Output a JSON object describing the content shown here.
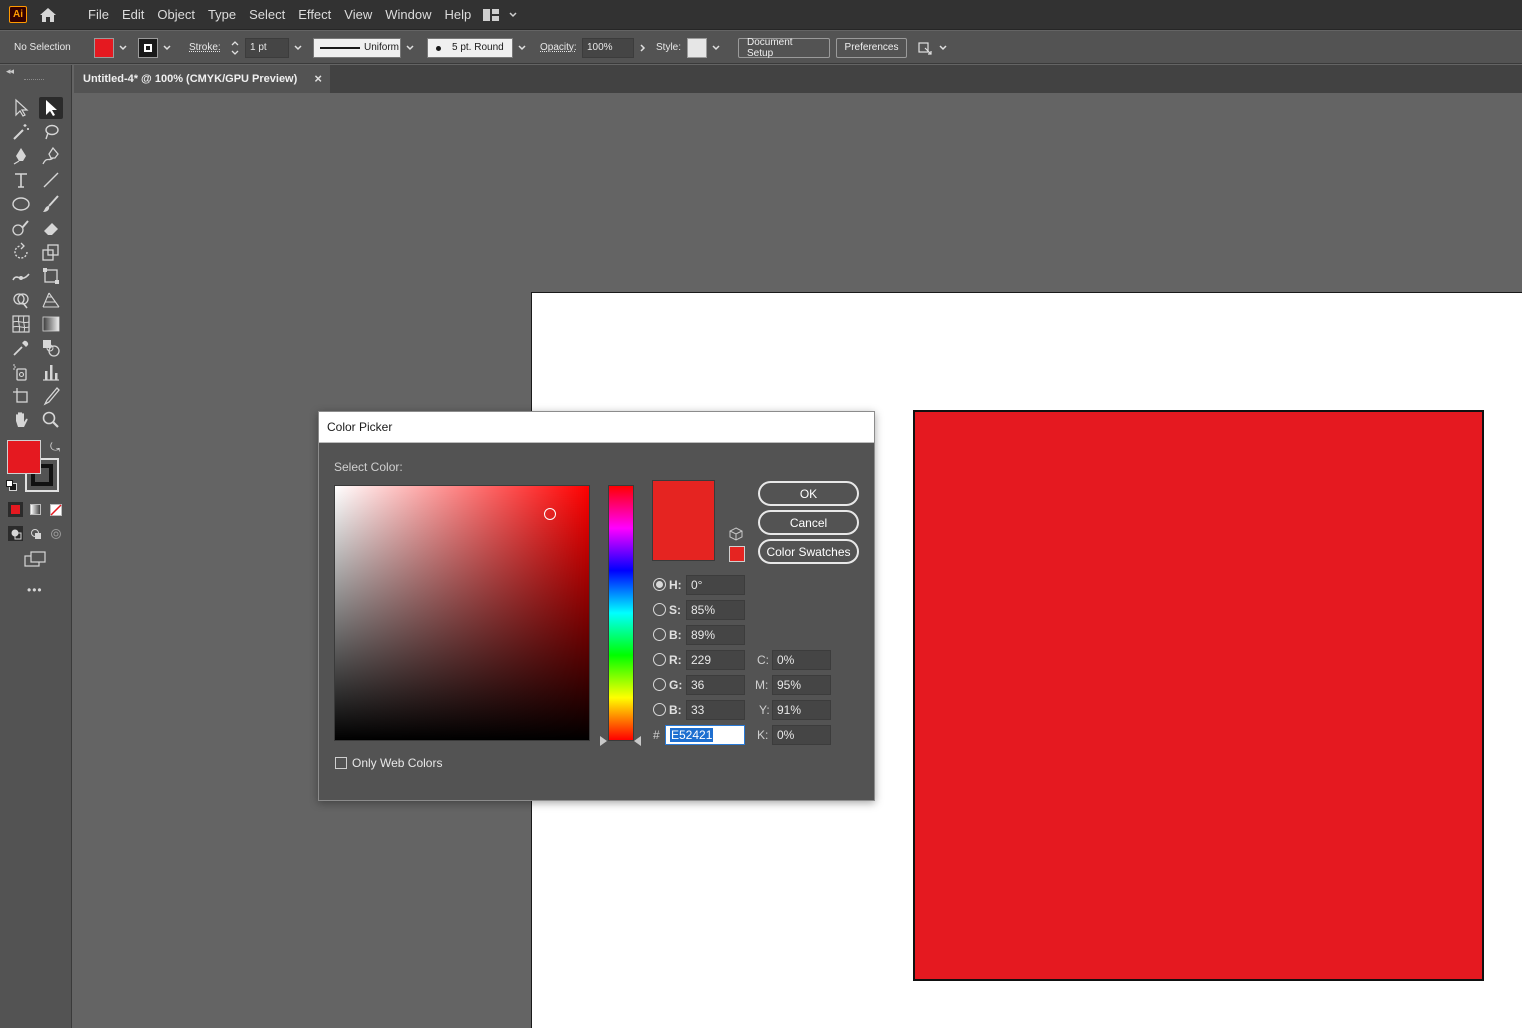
{
  "app": {
    "logo_text": "Ai"
  },
  "menu": [
    "File",
    "Edit",
    "Object",
    "Type",
    "Select",
    "Effect",
    "View",
    "Window",
    "Help"
  ],
  "controlbar": {
    "selection_status": "No Selection",
    "fill_color": "#e51920",
    "stroke_label": "Stroke:",
    "stroke_weight": "1 pt",
    "stroke_profile": "Uniform",
    "brush": "5 pt. Round",
    "opacity_label": "Opacity:",
    "opacity_value": "100%",
    "style_label": "Style:",
    "document_setup": "Document Setup",
    "preferences": "Preferences"
  },
  "tab": {
    "title": "Untitled-4* @ 100% (CMYK/GPU Preview)",
    "close": "×"
  },
  "toolbar": {
    "fill_color": "#e51920",
    "stroke_color": "#111111",
    "more": "•••"
  },
  "canvas": {
    "rect_color": "#e51920"
  },
  "dialog": {
    "title": "Color Picker",
    "select_color_label": "Select Color:",
    "preview_color": "#e52421",
    "ok": "OK",
    "cancel": "Cancel",
    "swatches": "Color Swatches",
    "hsb": [
      {
        "label": "H:",
        "value": "0°",
        "checked": true
      },
      {
        "label": "S:",
        "value": "85%",
        "checked": false
      },
      {
        "label": "B:",
        "value": "89%",
        "checked": false
      }
    ],
    "rgb": [
      {
        "label": "R:",
        "value": "229"
      },
      {
        "label": "G:",
        "value": "36"
      },
      {
        "label": "B:",
        "value": "33"
      }
    ],
    "hex_label": "#",
    "hex_value": "E52421",
    "cmyk": [
      {
        "label": "C:",
        "value": "0%"
      },
      {
        "label": "M:",
        "value": "95%"
      },
      {
        "label": "Y:",
        "value": "91%"
      },
      {
        "label": "K:",
        "value": "0%"
      }
    ],
    "only_web_colors": "Only Web Colors"
  }
}
